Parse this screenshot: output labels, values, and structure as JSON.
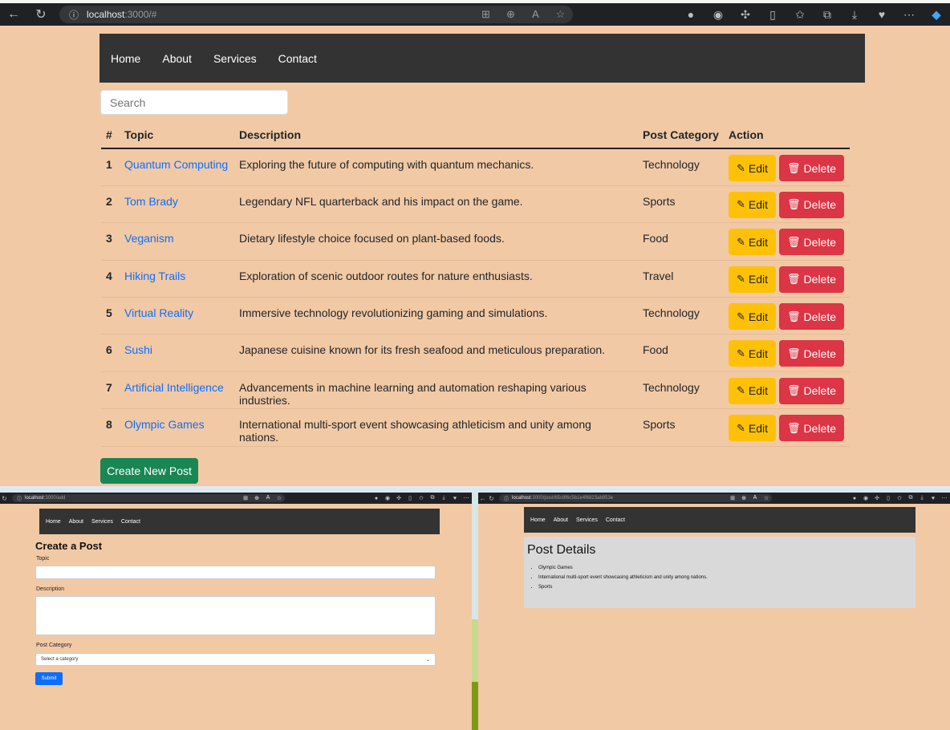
{
  "browser": {
    "url_host": "localhost",
    "url_path": ":3000/#"
  },
  "nav": [
    "Home",
    "About",
    "Services",
    "Contact"
  ],
  "search": {
    "placeholder": "Search"
  },
  "table": {
    "headers": [
      "#",
      "Topic",
      "Description",
      "Post Category",
      "Action"
    ],
    "rows": [
      {
        "num": "1",
        "topic": "Quantum Computing",
        "description": "Exploring the future of computing with quantum mechanics.",
        "category": "Technology"
      },
      {
        "num": "2",
        "topic": "Tom Brady",
        "description": "Legendary NFL quarterback and his impact on the game.",
        "category": "Sports"
      },
      {
        "num": "3",
        "topic": "Veganism",
        "description": "Dietary lifestyle choice focused on plant-based foods.",
        "category": "Food"
      },
      {
        "num": "4",
        "topic": "Hiking Trails",
        "description": "Exploration of scenic outdoor routes for nature enthusiasts.",
        "category": "Travel"
      },
      {
        "num": "5",
        "topic": "Virtual Reality",
        "description": "Immersive technology revolutionizing gaming and simulations.",
        "category": "Technology"
      },
      {
        "num": "6",
        "topic": "Sushi",
        "description": "Japanese cuisine known for its fresh seafood and meticulous preparation.",
        "category": "Food"
      },
      {
        "num": "7",
        "topic": "Artificial Intelligence",
        "description": "Advancements in machine learning and automation reshaping various industries.",
        "category": "Technology"
      },
      {
        "num": "8",
        "topic": "Olympic Games",
        "description": "International multi-sport event showcasing athleticism and unity among nations.",
        "category": "Sports"
      }
    ],
    "edit_label": "Edit",
    "delete_label": "Delete"
  },
  "create_button": "Create New Post",
  "create_page": {
    "url_host": "localhost",
    "url_path": ":3000/add",
    "title": "Create a Post",
    "topic_label": "Topic",
    "description_label": "Description",
    "category_label": "Post Category",
    "category_placeholder": "Select a category",
    "submit_label": "Submit"
  },
  "details_page": {
    "url_host": "localhost",
    "url_path": ":3000/post/65c8f6c5b1e4f6823ab953e",
    "title": "Post Details",
    "items": [
      "Olympic Games",
      "International multi-sport event showcasing athleticism and unity among nations.",
      "Sports"
    ]
  },
  "colors": {
    "page_bg": "#f2c9a5",
    "nav_bg": "#333333",
    "edit": "#ffc107",
    "delete": "#dc3545",
    "create": "#198754",
    "submit": "#0d6efd",
    "link": "#0d6efd"
  }
}
